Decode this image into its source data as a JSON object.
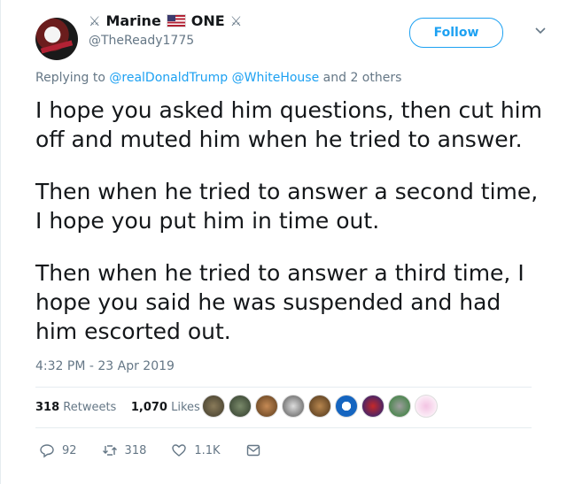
{
  "author": {
    "display_name_parts": [
      "Marine",
      "ONE"
    ],
    "handle": "@TheReady1775"
  },
  "follow_label": "Follow",
  "reply_context": {
    "prefix": "Replying to",
    "mentions": [
      "@realDonaldTrump",
      "@WhiteHouse"
    ],
    "suffix": "and 2 others"
  },
  "tweet": {
    "paragraphs": [
      "I hope you asked him questions, then cut him off and muted him when he tried to answer.",
      "Then when he tried to answer a second time, I hope you put him in time out.",
      "Then when he tried to answer a third time, I hope you said he was suspended and had him escorted out."
    ],
    "timestamp": "4:32 PM - 23 Apr 2019"
  },
  "stats": {
    "retweets_count": "318",
    "retweets_label": "Retweets",
    "likes_count": "1,070",
    "likes_label": "Likes"
  },
  "actions": {
    "reply_count": "92",
    "retweet_count": "318",
    "like_count": "1.1K"
  },
  "colors": {
    "accent": "#1da1f2",
    "muted": "#657786",
    "text": "#14171a",
    "divider": "#e6ecf0"
  },
  "icons": [
    "crossed-swords-icon",
    "us-flag-icon",
    "chevron-down-icon",
    "reply-icon",
    "retweet-icon",
    "like-icon",
    "direct-message-icon"
  ]
}
